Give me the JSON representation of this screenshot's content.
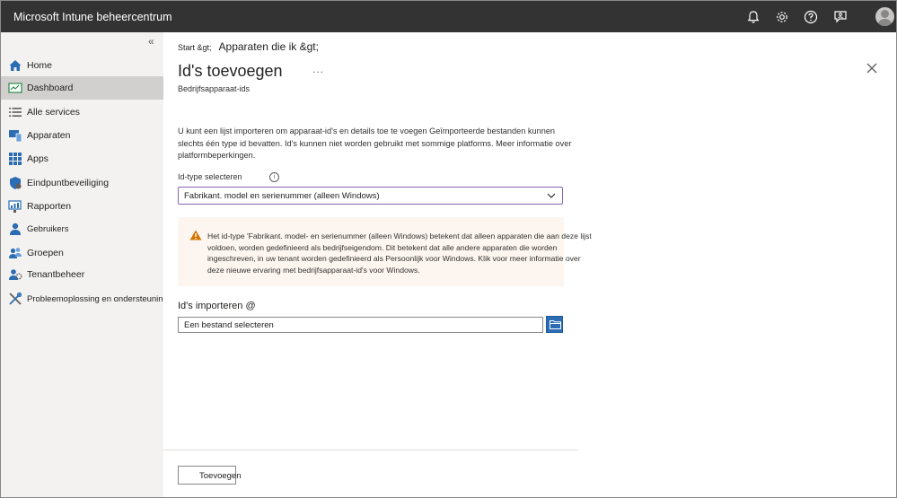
{
  "header": {
    "title": "Microsoft Intune beheercentrum",
    "icons": [
      "bell-icon",
      "gear-icon",
      "help-icon",
      "feedback-icon",
      "avatar"
    ]
  },
  "sidebar": {
    "collapse_glyph": "«",
    "items": [
      {
        "label": "Home",
        "icon": "home-icon"
      },
      {
        "label": "Dashboard",
        "icon": "dashboard-icon",
        "active": true
      },
      {
        "label": "Alle services",
        "icon": "list-icon"
      },
      {
        "label": "Apparaten",
        "icon": "devices-icon"
      },
      {
        "label": "Apps",
        "icon": "apps-grid-icon"
      },
      {
        "label": "Eindpuntbeveiliging",
        "icon": "shield-icon"
      },
      {
        "label": "Rapporten",
        "icon": "reports-icon"
      },
      {
        "label": "Gebruikers",
        "icon": "user-icon"
      },
      {
        "label": "Groepen",
        "icon": "groups-icon"
      },
      {
        "label": "Tenantbeheer",
        "icon": "tenant-icon"
      },
      {
        "label": "Probleemoplossing en ondersteuning",
        "icon": "wrench-icon"
      }
    ]
  },
  "breadcrumb": {
    "part1": "Start &gt;",
    "part2": "Apparaten die ik &gt;"
  },
  "page": {
    "title": "Id's toevoegen",
    "more": "...",
    "subtitle": "Bedrijfsapparaat-ids",
    "description": "U kunt een lijst importeren om apparaat-id's en details toe te voegen Geïmporteerde bestanden kunnen slechts één type id bevatten. Id's kunnen niet worden gebruikt met sommige platforms.",
    "description_link": "Meer informatie over platformbeperkingen."
  },
  "id_type": {
    "label": "Id-type selecteren",
    "selected": "Fabrikant. model en serienummer (alleen Windows)"
  },
  "warning": {
    "text": "Het id-type 'Fabrikant. model- en serienummer (alleen Windows) betekent dat alleen apparaten die aan deze lijst voldoen, worden gedefinieerd als bedrijfseigendom. Dit betekent dat alle andere apparaten die worden ingeschreven, in uw tenant worden gedefinieerd als Persoonlijk voor Windows. Klik voor meer informatie over deze nieuwe ervaring met bedrijfsapparaat-id's voor Windows."
  },
  "import": {
    "label": "Id's importeren @",
    "placeholder": "Een bestand selecteren"
  },
  "footer": {
    "add_label": "Toevoegen"
  },
  "colors": {
    "topbar": "#333333",
    "sidebar": "#f3f2f1",
    "sidebar_active": "#d2d0ce",
    "accent": "#2b6cb3",
    "dropdown_border": "#8764b8",
    "warning_bg": "#fdf6f0",
    "warning_icon": "#d47500"
  }
}
